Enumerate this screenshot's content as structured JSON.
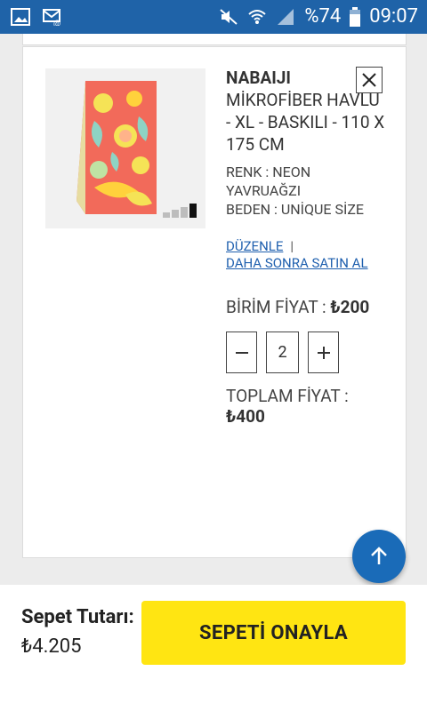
{
  "status": {
    "battery": "%74",
    "time": "09:07"
  },
  "product": {
    "brand": "NABAIJI",
    "name": "MİKROFİBER HAVLU - XL - BASKILI - 110 X 175 CM",
    "color_line": "RENK : NEON YAVRUAĞZI",
    "size_line": "BEDEN : UNİQUE SİZE",
    "edit_label": "DÜZENLE",
    "later_label": "DAHA SONRA SATIN AL",
    "unit_price_label": "BİRİM FİYAT :",
    "unit_price": "₺200",
    "quantity": "2",
    "total_label": "TOPLAM FİYAT :",
    "total_price": "₺400",
    "remove_icon": "close-icon"
  },
  "footer": {
    "cart_total_label": "Sepet Tutarı:",
    "cart_total": "₺4.205",
    "confirm_label": "SEPETİ ONAYLA"
  },
  "colors": {
    "status_bar": "#1f63a8",
    "accent": "#ffe512",
    "link": "#1e5fae",
    "fab": "#1a6bb8"
  }
}
